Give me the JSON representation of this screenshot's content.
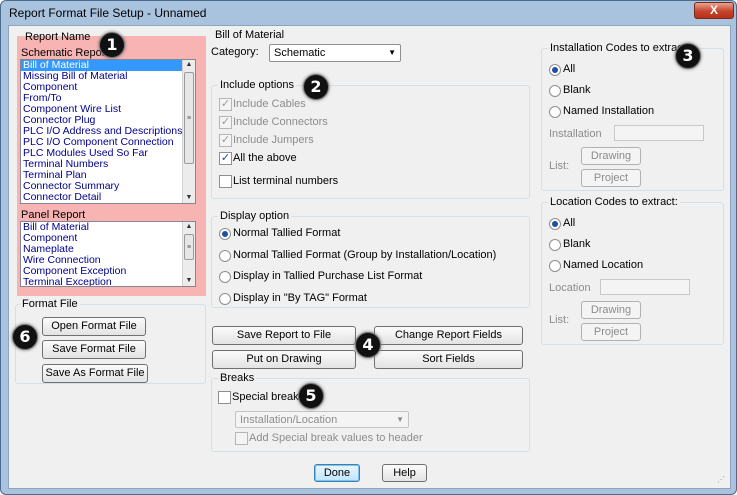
{
  "window": {
    "title": "Report Format File Setup - Unnamed",
    "close_label": "X"
  },
  "report_name": {
    "group_label": "Report Name",
    "schematic": {
      "label": "Schematic Report",
      "items": [
        "Bill of Material",
        "Missing Bill of Material",
        "Component",
        "From/To",
        "Component Wire List",
        "Connector Plug",
        "PLC I/O Address and Descriptions",
        "PLC I/O Component Connection",
        "PLC Modules Used So Far",
        "Terminal Numbers",
        "Terminal Plan",
        "Connector Summary",
        "Connector Detail"
      ],
      "selected_index": 0
    },
    "panel": {
      "label": "Panel Report",
      "items": [
        "Bill of Material",
        "Component",
        "Nameplate",
        "Wire Connection",
        "Component Exception",
        "Terminal Exception"
      ]
    }
  },
  "format_file": {
    "group_label": "Format File",
    "open_label": "Open Format File",
    "save_label": "Save Format File",
    "save_as_label": "Save As Format File"
  },
  "bom": {
    "group_label": "Bill of Material",
    "category_label": "Category:",
    "category_value": "Schematic",
    "include": {
      "label": "Include options",
      "cables": {
        "label": "Include Cables",
        "checked": true,
        "enabled": false
      },
      "connectors": {
        "label": "Include Connectors",
        "checked": true,
        "enabled": false
      },
      "jumpers": {
        "label": "Include Jumpers",
        "checked": true,
        "enabled": false
      },
      "all": {
        "label": "All the above",
        "checked": true,
        "enabled": true
      },
      "terminal": {
        "label": "List terminal numbers",
        "checked": false,
        "enabled": true
      }
    },
    "display": {
      "label": "Display option",
      "options": [
        {
          "label": "Normal Tallied Format",
          "selected": true
        },
        {
          "label": "Normal Tallied Format (Group by Installation/Location)",
          "selected": false
        },
        {
          "label": "Display in Tallied Purchase List Format",
          "selected": false
        },
        {
          "label": "Display in \"By TAG\" Format",
          "selected": false
        }
      ]
    }
  },
  "actions": {
    "save_report": "Save Report to File",
    "change_fields": "Change Report Fields",
    "put_drawing": "Put on Drawing",
    "sort_fields": "Sort Fields"
  },
  "breaks": {
    "label": "Breaks",
    "special_label": "Special breaks",
    "special_checked": false,
    "dropdown_value": "Installation/Location",
    "add_header_label": "Add Special break values to header"
  },
  "installation": {
    "group_label": "Installation Codes to extract:",
    "options": [
      "All",
      "Blank",
      "Named Installation"
    ],
    "selected_index": 0,
    "field_label": "Installation",
    "list_label": "List:",
    "drawing_label": "Drawing",
    "project_label": "Project"
  },
  "location": {
    "group_label": "Location Codes to extract:",
    "options": [
      "All",
      "Blank",
      "Named Location"
    ],
    "selected_index": 0,
    "field_label": "Location",
    "list_label": "List:",
    "drawing_label": "Drawing",
    "project_label": "Project"
  },
  "footer": {
    "done_label": "Done",
    "help_label": "Help"
  },
  "callouts": [
    "1",
    "2",
    "3",
    "4",
    "5",
    "6"
  ],
  "colors": {
    "highlight": "#ff8282",
    "selection": "#3399ff",
    "title_bar": "#a9c3df",
    "callout": "#111111"
  }
}
